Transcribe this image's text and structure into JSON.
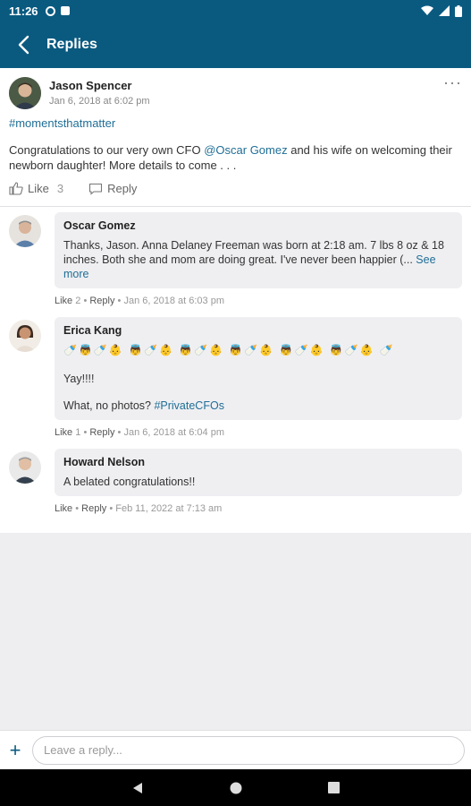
{
  "status_bar": {
    "time": "11:26"
  },
  "header": {
    "title": "Replies"
  },
  "post": {
    "author": "Jason Spencer",
    "date": "Jan 6, 2018 at 6:02 pm",
    "hashtag": "#momentsthatmatter",
    "text_before": "Congratulations to our very own CFO ",
    "mention": "@Oscar Gomez",
    "text_after": " and his wife on welcoming their newborn daughter! More details to come . . .",
    "like_label": "Like",
    "like_count": "3",
    "reply_label": "Reply",
    "more_label": "···"
  },
  "replies": [
    {
      "author": "Oscar Gomez",
      "text": "Thanks, Jason.  Anna Delaney Freeman was born at 2:18 am. 7 lbs 8 oz & 18 inches.  Both she and mom are doing great.  I've never been happier (... ",
      "see_more": "See more",
      "like_label": "Like",
      "like_count": "2",
      "reply_label": "Reply",
      "date": "Jan 6, 2018 at 6:03 pm",
      "avatar_color": "#c9b8a4"
    },
    {
      "author": "Erica Kang",
      "emoji_line": "🍼👼🍼👶 👼🍼👶 👼🍼👶 👼🍼👶 👼🍼👶 👼🍼👶 🍼",
      "line2": "Yay!!!!",
      "line3_text": "What, no photos?  ",
      "line3_tag": "#PrivateCFOs",
      "like_label": "Like",
      "like_count": "1",
      "reply_label": "Reply",
      "date": "Jan 6, 2018 at 6:04 pm",
      "avatar_color": "#b58563"
    },
    {
      "author": "Howard Nelson",
      "text": "A belated congratulations!!",
      "like_label": "Like",
      "reply_label": "Reply",
      "date": "Feb 11, 2022 at 7:13 am",
      "avatar_color": "#a9a9a9"
    }
  ],
  "composer": {
    "placeholder": "Leave a reply...",
    "plus": "+"
  },
  "colors": {
    "brand": "#0a5a80",
    "link": "#1f6e96"
  }
}
